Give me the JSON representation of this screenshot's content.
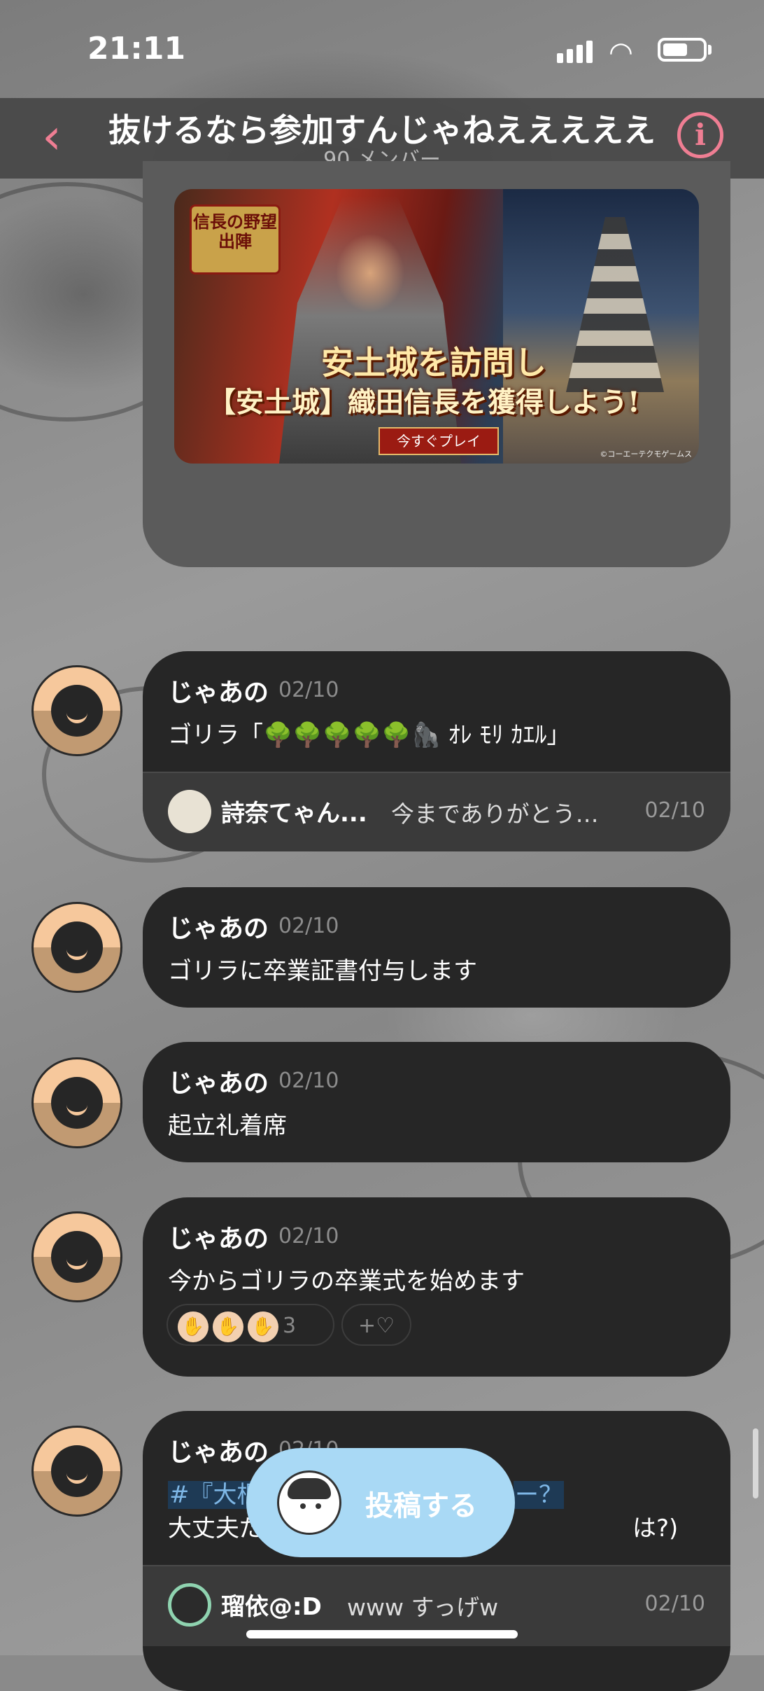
{
  "status": {
    "time": "21:11"
  },
  "header": {
    "title": "抜けるなら参加すんじゃねえええええ",
    "subtitle": "90 メンバー",
    "back_icon": "chevron-left-icon",
    "info_icon": "info-icon",
    "accent": "#ef7e93"
  },
  "banner": {
    "logo": "信長の野望 出陣",
    "headline1": "安土城を訪問し",
    "headline2": "【安土城】織田信長を獲得しよう!",
    "play": "今すぐプレイ",
    "copyright": "©コーエーテクモゲームス"
  },
  "messages": [
    {
      "name": "じゃあの",
      "date": "02/10",
      "text": "ゴリラ「🌳🌳🌳🌳🌳🦍 ｵﾚ ﾓﾘ ｶｴﾙ」",
      "reply": {
        "name": "詩奈てゃん...",
        "text": "今までありがとう…",
        "date": "02/10"
      }
    },
    {
      "name": "じゃあの",
      "date": "02/10",
      "text": "ゴリラに卒業証書付与します"
    },
    {
      "name": "じゃあの",
      "date": "02/10",
      "text": "起立礼着席"
    },
    {
      "name": "じゃあの",
      "date": "02/10",
      "text": "今からゴリラの卒業式を始めます",
      "reactions": {
        "count": "3",
        "add_label": "+♡"
      }
    },
    {
      "name": "じゃあの",
      "date": "02/10",
      "hashtag": "#『大根",
      "hashtag_tail": "ー？",
      "text": "大丈夫だ",
      "text_tail": "は?)",
      "reply": {
        "name": "瑠依@:D",
        "text": "www すっげw",
        "date": "02/10"
      }
    }
  ],
  "post_button": {
    "label": "投稿する",
    "color": "#a9d9f5"
  }
}
